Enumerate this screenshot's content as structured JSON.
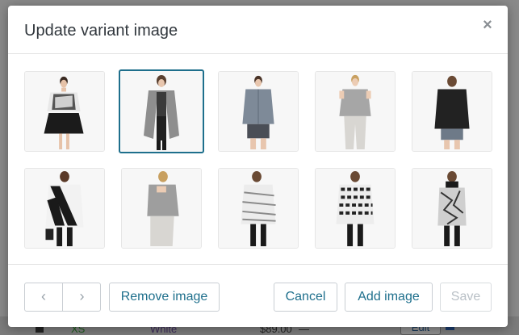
{
  "modal": {
    "title": "Update variant image",
    "close_label": "×"
  },
  "images": [
    {
      "name": "product-image-1",
      "outfit": "black-white-top-black-skirt",
      "selected": false
    },
    {
      "name": "product-image-2",
      "outfit": "grey-cardigan",
      "selected": true
    },
    {
      "name": "product-image-3",
      "outfit": "chambray-shirt",
      "selected": false
    },
    {
      "name": "product-image-4",
      "outfit": "grey-sweater-sweatpants",
      "selected": false
    },
    {
      "name": "product-image-5",
      "outfit": "black-hoodie-back",
      "selected": false
    },
    {
      "name": "product-image-6",
      "outfit": "black-white-striped-top",
      "selected": false
    },
    {
      "name": "product-image-7",
      "outfit": "grey-sweater-back",
      "selected": false
    },
    {
      "name": "product-image-8",
      "outfit": "white-print-top",
      "selected": false
    },
    {
      "name": "product-image-9",
      "outfit": "black-white-print-top-back",
      "selected": false
    },
    {
      "name": "product-image-10",
      "outfit": "print-top-back",
      "selected": false
    }
  ],
  "footer": {
    "prev_icon": "‹",
    "next_icon": "›",
    "remove_label": "Remove image",
    "cancel_label": "Cancel",
    "add_label": "Add image",
    "save_label": "Save"
  },
  "background_row": {
    "size": "XS",
    "color": "White",
    "price": "$89.00",
    "dash": "—",
    "edit_label": "Edit"
  },
  "colors": {
    "accent": "#1e6f8c",
    "selected_border": "#1e6f8c",
    "disabled_text": "#b9c0c6"
  }
}
